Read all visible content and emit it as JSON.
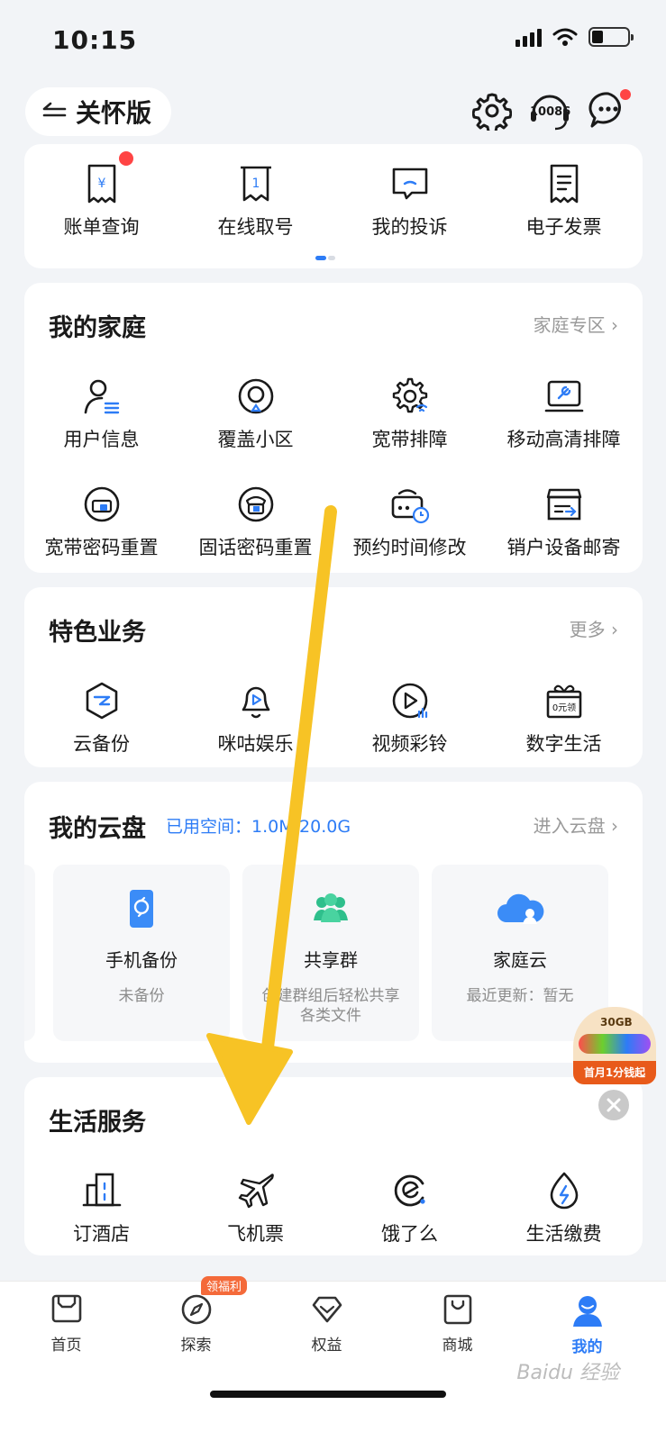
{
  "status": {
    "time": "10:15"
  },
  "header": {
    "care_label": "关怀版",
    "hotline": "10086"
  },
  "quick": {
    "items": [
      {
        "label": "账单查询",
        "icon": "bill-icon"
      },
      {
        "label": "在线取号",
        "icon": "ticket-icon"
      },
      {
        "label": "我的投诉",
        "icon": "complaint-icon"
      },
      {
        "label": "电子发票",
        "icon": "invoice-icon"
      }
    ]
  },
  "family": {
    "title": "我的家庭",
    "more": "家庭专区",
    "items": [
      {
        "label": "用户信息",
        "icon": "user-info-icon"
      },
      {
        "label": "覆盖小区",
        "icon": "coverage-icon"
      },
      {
        "label": "宽带排障",
        "icon": "broadband-fix-icon"
      },
      {
        "label": "移动高清排障",
        "icon": "tv-fix-icon"
      },
      {
        "label": "宽带密码重置",
        "icon": "broadband-password-icon"
      },
      {
        "label": "固话密码重置",
        "icon": "phone-password-icon"
      },
      {
        "label": "预约时间修改",
        "icon": "appointment-icon"
      },
      {
        "label": "销户设备邮寄",
        "icon": "device-mail-icon"
      }
    ]
  },
  "featured": {
    "title": "特色业务",
    "more": "更多",
    "items": [
      {
        "label": "云备份",
        "icon": "cloud-backup-icon"
      },
      {
        "label": "咪咕娱乐",
        "icon": "migu-icon"
      },
      {
        "label": "视频彩铃",
        "icon": "video-ring-icon"
      },
      {
        "label": "数字生活",
        "icon": "digital-life-icon",
        "tag": "0元领"
      }
    ]
  },
  "cloud": {
    "title": "我的云盘",
    "used": "已用空间：1.0M/20.0G",
    "more": "进入云盘",
    "tiles": [
      {
        "title": "手机备份",
        "sub": "未备份"
      },
      {
        "title": "共享群",
        "sub": "创建群组后轻松共享各类文件"
      },
      {
        "title": "家庭云",
        "sub": "最近更新：暂无"
      }
    ]
  },
  "life": {
    "title": "生活服务",
    "items": [
      {
        "label": "订酒店",
        "icon": "hotel-icon"
      },
      {
        "label": "飞机票",
        "icon": "plane-icon"
      },
      {
        "label": "饿了么",
        "icon": "eleme-icon"
      },
      {
        "label": "生活缴费",
        "icon": "utility-icon"
      }
    ]
  },
  "promo": {
    "size": "30GB",
    "text": "首月1分钱起"
  },
  "tabs": [
    {
      "label": "首页"
    },
    {
      "label": "探索",
      "badge": "领福利"
    },
    {
      "label": "权益"
    },
    {
      "label": "商城"
    },
    {
      "label": "我的",
      "active": true
    }
  ],
  "watermark": "Baidu 经验",
  "colors": {
    "accent": "#2d7cf6",
    "arrow": "#f7c325",
    "alert": "#f44336"
  }
}
